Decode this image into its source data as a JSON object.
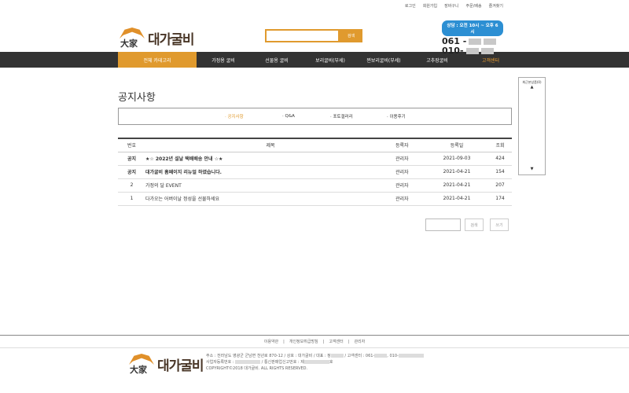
{
  "topbar": {
    "links": [
      "로그인",
      "회원가입",
      "장바구니",
      "주문/배송",
      "즐겨찾기"
    ]
  },
  "header": {
    "logo_han": "大家",
    "logo_text": "대가굴비",
    "search_button": "검색",
    "cs_hours": "상담 : 오전 10시 ~ 오후 6시",
    "phone1": "061 -",
    "phone2": "010-"
  },
  "nav": {
    "all": "전체 카테고리",
    "items": [
      "가정용 굴비",
      "선물용 굴비",
      "보리굴비(부세)",
      "찐보리굴비(부세)",
      "고추장굴비"
    ],
    "cs": "고객센터"
  },
  "sidebar": {
    "title": "최근본상품(0)",
    "up": "▲",
    "down": "▼"
  },
  "page": {
    "title": "공지사항"
  },
  "subnav": [
    "· 공지사항",
    "· Q&A",
    "· 포토갤러리",
    "· 이용후기"
  ],
  "board": {
    "headers": [
      "번호",
      "제목",
      "등록자",
      "등록일",
      "조회"
    ],
    "rows": [
      {
        "no": "공지",
        "title": "★☆ 2022년 설날 택배배송 안내 ☆★",
        "writer": "관리자",
        "date": "2021-09-03",
        "views": "424"
      },
      {
        "no": "공지",
        "title": "대가굴비 홈페이지 리뉴얼 하였습니다.",
        "writer": "관리자",
        "date": "2021-04-21",
        "views": "154"
      },
      {
        "no": "2",
        "title": "가정의 달 EVENT",
        "writer": "관리자",
        "date": "2021-04-21",
        "views": "207"
      },
      {
        "no": "1",
        "title": "다가오는 어버이날 정성을 선물하세요",
        "writer": "관리자",
        "date": "2021-04-21",
        "views": "174"
      }
    ],
    "search_button": "검색",
    "write_button": "쓰기"
  },
  "footer": {
    "links": [
      "이용약관",
      "|",
      "개인정보취급방침",
      "|",
      "고객센터",
      "|",
      "관리자"
    ],
    "line1_a": "주소 : 전라남도 영광군 군남면 천년로 870-12   /   상호 : 대가굴비   /   대표 : 정",
    "line1_b": "   /   고객센터 : 061-",
    "line1_c": ", 010-",
    "line2_a": "사업자등록번호 : ",
    "line2_b": "   /   통신판매업신고번호 : 제",
    "line2_c": "호",
    "line3": "COPYRIGHT©2018 대가굴비. ALL RIGHTS RESERVED."
  }
}
